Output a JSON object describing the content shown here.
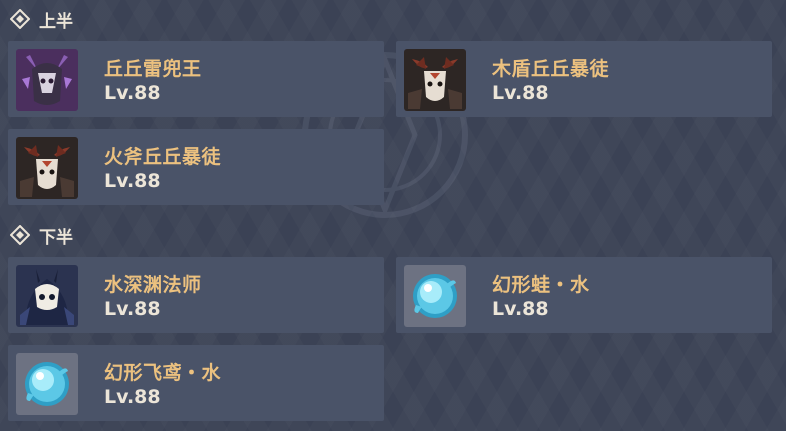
{
  "sections": [
    {
      "title": "上半",
      "enemies": [
        {
          "name": "丘丘雷兜王",
          "level": "Lv.88",
          "icon": "lawachurl-icon"
        },
        {
          "name": "木盾丘丘暴徒",
          "level": "Lv.88",
          "icon": "mitachurl-icon"
        },
        {
          "name": "火斧丘丘暴徒",
          "level": "Lv.88",
          "icon": "mitachurl-icon"
        }
      ]
    },
    {
      "title": "下半",
      "enemies": [
        {
          "name": "水深渊法师",
          "level": "Lv.88",
          "icon": "abyss-mage-icon"
        },
        {
          "name": "幻形蛙・水",
          "level": "Lv.88",
          "icon": "hydro-orb-icon"
        },
        {
          "name": "幻形飞鸢・水",
          "level": "Lv.88",
          "icon": "hydro-orb-icon"
        }
      ]
    }
  ],
  "colors": {
    "background": "#3b4255",
    "card": "#4a5368",
    "name": "#ecc17f",
    "level": "#ece5d8"
  }
}
